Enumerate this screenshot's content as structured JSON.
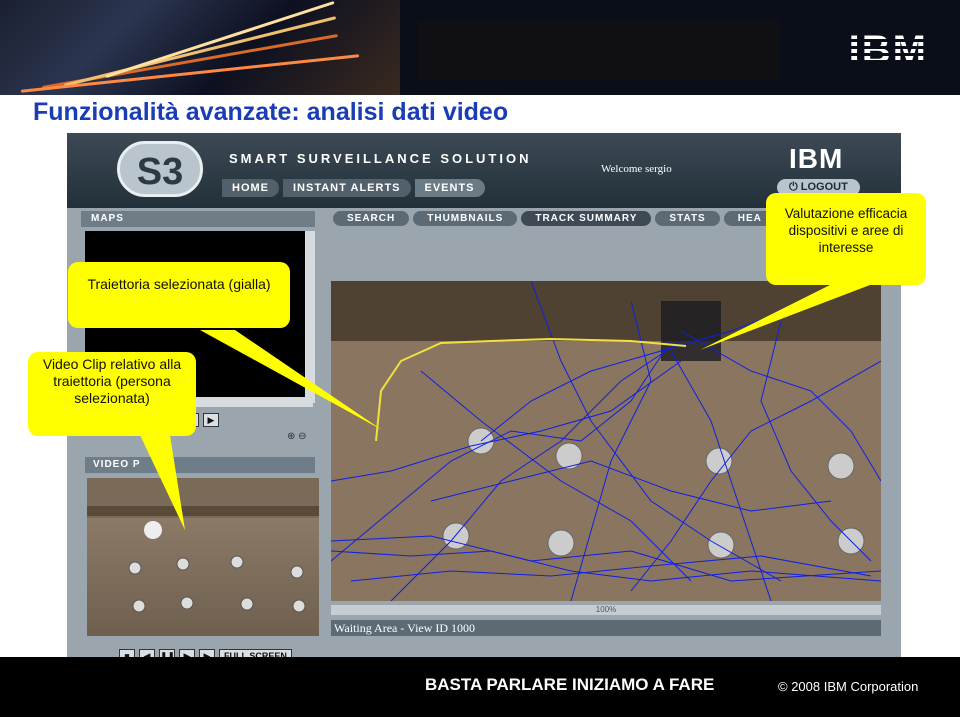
{
  "slide": {
    "title": "Funzionalità avanzate: analisi dati video",
    "ibm_logo": "IBM",
    "footer_text": "BASTA PARLARE  INIZIAMO A FARE",
    "copyright": "© 2008 IBM Corporation"
  },
  "app": {
    "logo": "S3",
    "title": "SMART SURVEILLANCE SOLUTION",
    "welcome": "Welcome sergio",
    "ibm_logo": "IBM",
    "nav": [
      "HOME",
      "INSTANT ALERTS",
      "EVENTS"
    ],
    "logout_label": "LOGOUT",
    "maps_label": "MAPS",
    "tabs": [
      "SEARCH",
      "THUMBNAILS",
      "TRACK SUMMARY",
      "STATS",
      "HEA"
    ],
    "video_player_label": "VIDEO P",
    "fullscreen_label": "FULL SCREEN",
    "progress_label": "100%",
    "view_label": "Waiting Area - View ID 1000"
  },
  "callouts": {
    "trajectory": "Traiettoria selezionata (gialla)",
    "efficacy": "Valutazione efficacia dispositivi e aree di interesse",
    "videoclip": "Video Clip relativo alla traiettoria (persona selezionata)"
  },
  "icons": {
    "media_controls": [
      "stop-icon",
      "step-back-icon",
      "pause-icon",
      "play-icon",
      "step-forward-icon"
    ],
    "map_controls": [
      "back-icon",
      "play-icon"
    ],
    "zoom": [
      "zoom-in-icon",
      "zoom-out-icon"
    ]
  },
  "colors": {
    "title_blue": "#1a3cb4",
    "callout_yellow": "#ffff00",
    "track_blue": "#1020e0",
    "selected_track_yellow": "#f0e040"
  }
}
